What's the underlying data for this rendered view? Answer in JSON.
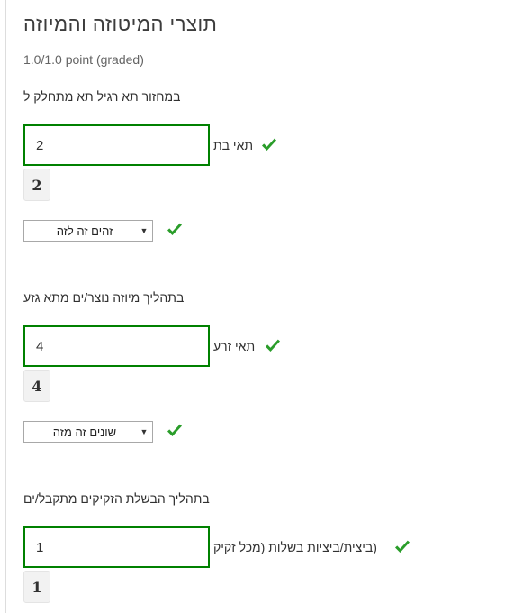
{
  "problem": {
    "title": "תוצרי המיטוזה והמיוזה",
    "score": "1.0/1.0 point (graded)"
  },
  "questions": [
    {
      "text": "במחזור תא רגיל תא מתחלק ל",
      "input_value": "2",
      "input_label": "תאי בת",
      "preview": "2",
      "select_value": "זהים זה לזה"
    },
    {
      "text": "בתהליך מיוזה נוצר/ים מתא גזע",
      "input_value": "4",
      "input_label": "תאי זרע",
      "preview": "4",
      "select_value": "שונים זה מזה"
    },
    {
      "text": "בתהליך הבשלת הזקיקים מתקבל/ים",
      "input_value": "1",
      "input_label": "(ביצית/ביציות בשלות (מכל זקיק",
      "preview": "1"
    }
  ],
  "colors": {
    "correct": "#008100",
    "check": "#2a9d2a"
  },
  "icons": {
    "status": "checkmark-icon",
    "dropdown": "triangle-down-icon"
  }
}
